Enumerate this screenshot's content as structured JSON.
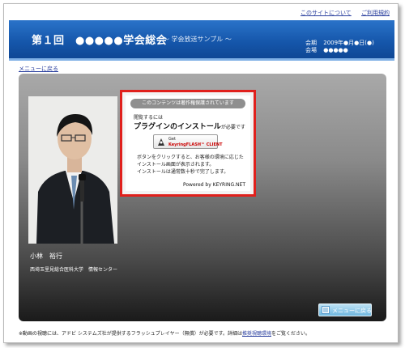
{
  "toplinks": {
    "about": "このサイトについて",
    "help": "ご利用規約"
  },
  "header": {
    "title": "第１回　●●●●●学会総会",
    "subtitle": "～ 学会放送サンプル ～",
    "meta": {
      "date_label": "会期",
      "date_value": "2009年●月●日(●)",
      "venue_label": "会場",
      "venue_value": "●●●●●"
    }
  },
  "nav": {
    "back_to_menu_link": "メニューに戻る"
  },
  "speaker": {
    "name": "小林　裕行",
    "affiliation": "西埼玉里見総合医科大学　情報センター"
  },
  "plugin_notice": {
    "banner": "このコンテンツは著作権保護されています",
    "lead1": "閲覧するには",
    "lead2": "プラグインのインストール",
    "lead2_suffix": "が必要です",
    "get_button_line1": "Get",
    "get_button_line2": "KeyringFLASH™ CLIENT",
    "desc_line1": "ボタンをクリックすると、お客様の環境に応じた",
    "desc_line2": "インストール画面が表示されます。",
    "desc_line3": "インストールは通常数十秒で完了します。",
    "powered": "Powered by KEYRING.NET"
  },
  "menu_button": {
    "label": "メニューに戻る"
  },
  "footnote": {
    "text_before": "※動画の視聴には、アドビ システムズ社が提供するフラッシュプレイヤー（無償）が必要です。詳細は",
    "link": "推奨視聴環境",
    "text_after": "をご覧ください。"
  },
  "colors": {
    "header_blue": "#1556aa",
    "notice_border": "#e0201c",
    "link": "#2a3f9e"
  }
}
